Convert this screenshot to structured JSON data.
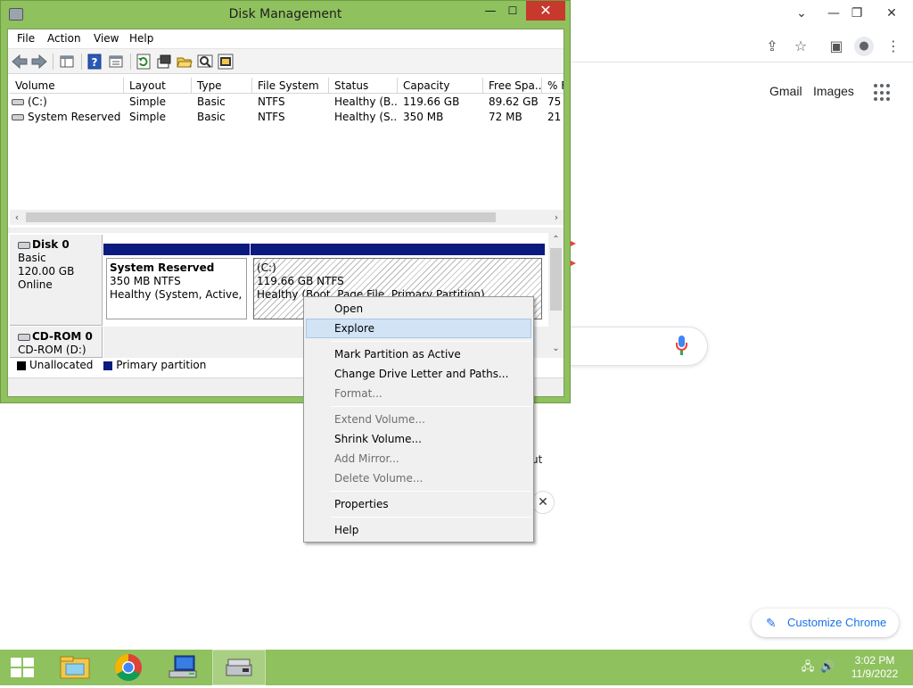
{
  "chrome": {
    "links": {
      "gmail": "Gmail",
      "images": "Images"
    },
    "customize_label": "Customize Chrome",
    "fragment_text": "ut",
    "controls": {
      "minimize": "⌄",
      "restore": "—",
      "maximize": "❐",
      "close": "✕"
    },
    "toolbar_icons": [
      "share-icon",
      "star-icon",
      "side-panel-icon",
      "profile-icon",
      "kebab-menu-icon"
    ]
  },
  "window": {
    "title": "Disk Management",
    "controls": {
      "minimize": "—",
      "maximize": "☐",
      "close": "✕"
    }
  },
  "menubar": [
    "File",
    "Action",
    "View",
    "Help"
  ],
  "volume_table": {
    "columns": [
      "Volume",
      "Layout",
      "Type",
      "File System",
      "Status",
      "Capacity",
      "Free Spa...",
      "% F"
    ],
    "rows": [
      [
        "(C:)",
        "Simple",
        "Basic",
        "NTFS",
        "Healthy (B...",
        "119.66 GB",
        "89.62 GB",
        "75"
      ],
      [
        "System Reserved",
        "Simple",
        "Basic",
        "NTFS",
        "Healthy (S...",
        "350 MB",
        "72 MB",
        "21"
      ]
    ]
  },
  "disks": [
    {
      "name": "Disk 0",
      "type": "Basic",
      "size": "120.00 GB",
      "status": "Online"
    },
    {
      "name": "CD-ROM 0",
      "type": "CD-ROM (D:)"
    }
  ],
  "partitions": [
    {
      "title": "System Reserved",
      "size": "350 MB NTFS",
      "status": "Healthy (System, Active, Primary Partition)"
    },
    {
      "title": "(C:)",
      "size": "119.66 GB NTFS",
      "status": "Healthy (Boot, Page File, Primary Partition)"
    }
  ],
  "legend": [
    {
      "label": "Unallocated",
      "color": "#000000"
    },
    {
      "label": "Primary partition",
      "color": "#0a1a7e"
    }
  ],
  "context_menu": {
    "items": [
      {
        "label": "Open",
        "enabled": true
      },
      {
        "label": "Explore",
        "enabled": true,
        "highlighted": true
      },
      {
        "label": "Mark Partition as Active",
        "enabled": true
      },
      {
        "label": "Change Drive Letter and Paths...",
        "enabled": true
      },
      {
        "label": "Format...",
        "enabled": false
      },
      {
        "label": "Extend Volume...",
        "enabled": false
      },
      {
        "label": "Shrink Volume...",
        "enabled": true
      },
      {
        "label": "Add Mirror...",
        "enabled": false
      },
      {
        "label": "Delete Volume...",
        "enabled": false
      },
      {
        "label": "Properties",
        "enabled": true
      },
      {
        "label": "Help",
        "enabled": true
      }
    ]
  },
  "taskbar": {
    "apps": [
      "start-icon",
      "file-explorer-icon",
      "chrome-icon",
      "network-computer-icon",
      "disk-management-icon"
    ],
    "clock": {
      "time": "3:02 PM",
      "date": "11/9/2022"
    }
  },
  "colors": {
    "window_frame": "#8fc15f",
    "close_red": "#c7392c",
    "partition_bar": "#0a1a7e",
    "menu_highlight": "#d1e3f5",
    "chrome_accent": "#1a73e8"
  }
}
